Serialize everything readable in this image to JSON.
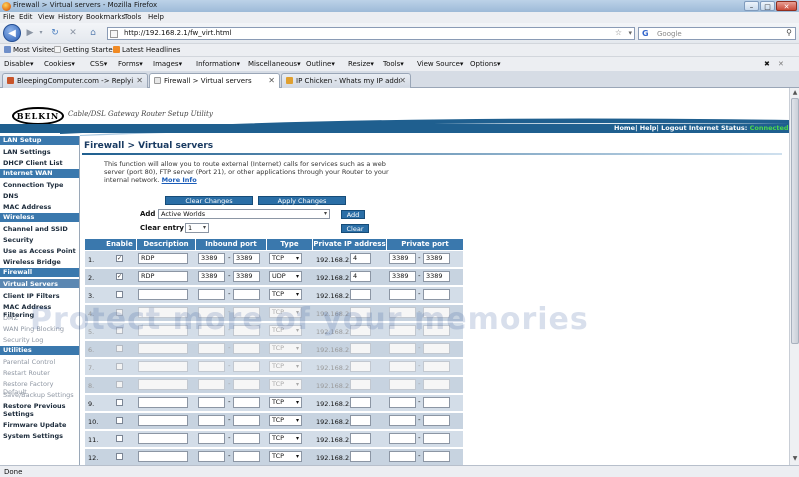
{
  "window": {
    "title": "Firewall > Virtual servers - Mozilla Firefox",
    "controls": {
      "minimize": "–",
      "maximize": "□",
      "close": "✕"
    }
  },
  "menu": [
    "File",
    "Edit",
    "View",
    "History",
    "Bookmarks",
    "Tools",
    "Help"
  ],
  "nav": {
    "url": "http://192.168.2.1/fw_virt.html",
    "search_placeholder": "Google",
    "search_engine_letter": "G"
  },
  "bookmarks": [
    "Most Visited",
    "Getting Started",
    "Latest Headlines"
  ],
  "devbar": [
    "Disable▾",
    "Cookies▾",
    "CSS▾",
    "Forms▾",
    "Images▾",
    "Information▾",
    "Miscellaneous▾",
    "Outline▾",
    "Resize▾",
    "Tools▾",
    "View Source▾",
    "Options▾"
  ],
  "tabs": [
    {
      "label": "BleepingComputer.com -> Replyin...",
      "active": false
    },
    {
      "label": "Firewall > Virtual servers",
      "active": true
    },
    {
      "label": "IP Chicken - Whats my IP address? i...",
      "active": false
    }
  ],
  "status": "Done",
  "router": {
    "brand": "BELKIN",
    "tagline": "Cable/DSL Gateway Router Setup Utility",
    "toplinks": "Home| Help| Logout   Internet Status:",
    "internet_status": "Connected",
    "sidebar": [
      {
        "type": "head",
        "label": "LAN Setup"
      },
      {
        "type": "item",
        "label": "LAN Settings"
      },
      {
        "type": "item",
        "label": "DHCP Client List"
      },
      {
        "type": "head",
        "label": "Internet WAN"
      },
      {
        "type": "item",
        "label": "Connection Type"
      },
      {
        "type": "item",
        "label": "DNS"
      },
      {
        "type": "item",
        "label": "MAC Address"
      },
      {
        "type": "head",
        "label": "Wireless"
      },
      {
        "type": "item",
        "label": "Channel and SSID"
      },
      {
        "type": "item",
        "label": "Security"
      },
      {
        "type": "item",
        "label": "Use as Access Point"
      },
      {
        "type": "item",
        "label": "Wireless Bridge"
      },
      {
        "type": "head",
        "label": "Firewall"
      },
      {
        "type": "current",
        "label": "Virtual Servers"
      },
      {
        "type": "item",
        "label": "Client IP Filters"
      },
      {
        "type": "item",
        "label": "MAC Address Filtering"
      },
      {
        "type": "dim",
        "label": "DMZ"
      },
      {
        "type": "dim",
        "label": "WAN Ping Blocking"
      },
      {
        "type": "dim",
        "label": "Security Log"
      },
      {
        "type": "head",
        "label": "Utilities"
      },
      {
        "type": "dim",
        "label": "Parental Control"
      },
      {
        "type": "dim",
        "label": "Restart Router"
      },
      {
        "type": "dim",
        "label": "Restore Factory Default"
      },
      {
        "type": "dim",
        "label": "Save/Backup Settings"
      },
      {
        "type": "item",
        "label": "Restore Previous Settings"
      },
      {
        "type": "item",
        "label": "Firmware Update"
      },
      {
        "type": "item",
        "label": "System Settings"
      }
    ],
    "page_title": "Firewall > Virtual servers",
    "description": "This function will allow you to route external (Internet) calls for services such as a web server (port 80), FTP server (Port 21), or other applications through your Router to your internal network.",
    "more_info": "More Info",
    "clear_changes": "Clear Changes",
    "apply_changes": "Apply Changes",
    "add_label": "Add",
    "add_select": "Active Worlds",
    "add_button": "Add",
    "clear_entry_label": "Clear entry",
    "clear_entry_select": "1",
    "clear_button": "Clear",
    "watermark": "Protect more of your memories",
    "columns": {
      "enable": "Enable",
      "description": "Description",
      "inbound": "Inbound port",
      "type": "Type",
      "private_ip": "Private IP address",
      "private_port": "Private port"
    },
    "ip_prefix": "192.168.2.",
    "rows": [
      {
        "num": "1.",
        "enabled": true,
        "desc": "RDP",
        "in_start": "3389",
        "in_end": "3389",
        "type": "TCP",
        "ip_last": "4",
        "pp_start": "3389",
        "pp_end": "3389",
        "dim": false
      },
      {
        "num": "2.",
        "enabled": true,
        "desc": "RDP",
        "in_start": "3389",
        "in_end": "3389",
        "type": "UDP",
        "ip_last": "4",
        "pp_start": "3389",
        "pp_end": "3389",
        "dim": false
      },
      {
        "num": "3.",
        "enabled": false,
        "desc": "",
        "in_start": "",
        "in_end": "",
        "type": "TCP",
        "ip_last": "",
        "pp_start": "",
        "pp_end": "",
        "dim": false
      },
      {
        "num": "4.",
        "enabled": false,
        "desc": "",
        "in_start": "",
        "in_end": "",
        "type": "TCP",
        "ip_last": "",
        "pp_start": "",
        "pp_end": "",
        "dim": true
      },
      {
        "num": "5.",
        "enabled": false,
        "desc": "",
        "in_start": "",
        "in_end": "",
        "type": "TCP",
        "ip_last": "",
        "pp_start": "",
        "pp_end": "",
        "dim": true
      },
      {
        "num": "6.",
        "enabled": false,
        "desc": "",
        "in_start": "",
        "in_end": "",
        "type": "TCP",
        "ip_last": "",
        "pp_start": "",
        "pp_end": "",
        "dim": true
      },
      {
        "num": "7.",
        "enabled": false,
        "desc": "",
        "in_start": "",
        "in_end": "",
        "type": "TCP",
        "ip_last": "",
        "pp_start": "",
        "pp_end": "",
        "dim": true
      },
      {
        "num": "8.",
        "enabled": false,
        "desc": "",
        "in_start": "",
        "in_end": "",
        "type": "TCP",
        "ip_last": "",
        "pp_start": "",
        "pp_end": "",
        "dim": true
      },
      {
        "num": "9.",
        "enabled": false,
        "desc": "",
        "in_start": "",
        "in_end": "",
        "type": "TCP",
        "ip_last": "",
        "pp_start": "",
        "pp_end": "",
        "dim": false
      },
      {
        "num": "10.",
        "enabled": false,
        "desc": "",
        "in_start": "",
        "in_end": "",
        "type": "TCP",
        "ip_last": "",
        "pp_start": "",
        "pp_end": "",
        "dim": false
      },
      {
        "num": "11.",
        "enabled": false,
        "desc": "",
        "in_start": "",
        "in_end": "",
        "type": "TCP",
        "ip_last": "",
        "pp_start": "",
        "pp_end": "",
        "dim": false
      },
      {
        "num": "12.",
        "enabled": false,
        "desc": "",
        "in_start": "",
        "in_end": "",
        "type": "TCP",
        "ip_last": "",
        "pp_start": "",
        "pp_end": "",
        "dim": false
      }
    ]
  }
}
